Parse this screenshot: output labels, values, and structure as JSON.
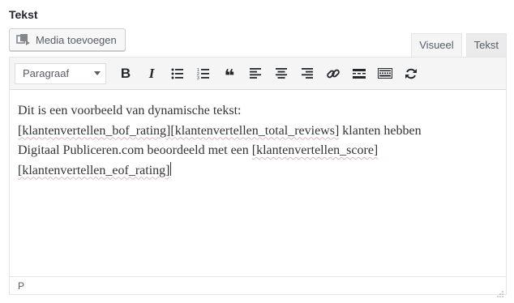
{
  "field": {
    "label": "Tekst"
  },
  "media": {
    "button_label": "Media toevoegen",
    "icon": "media-icon"
  },
  "tabs": {
    "visual": "Visueel",
    "text": "Tekst"
  },
  "toolbar": {
    "format_value": "Paragraaf",
    "buttons": [
      {
        "name": "bold-icon",
        "glyph": "B"
      },
      {
        "name": "italic-icon",
        "glyph": "I"
      },
      {
        "name": "bullet-list-icon"
      },
      {
        "name": "numbered-list-icon"
      },
      {
        "name": "blockquote-icon",
        "glyph": "❝"
      },
      {
        "name": "align-left-icon"
      },
      {
        "name": "align-center-icon"
      },
      {
        "name": "align-right-icon"
      },
      {
        "name": "link-icon"
      },
      {
        "name": "read-more-icon"
      },
      {
        "name": "toolbar-toggle-icon"
      },
      {
        "name": "refresh-icon"
      }
    ]
  },
  "content": {
    "line1": "Dit is een voorbeeld van dynamische tekst:",
    "sc_bof": "[klantenvertellen_bof_rating]",
    "sc_total": "[klantenvertellen_total_reviews]",
    "text_after_total": " klanten hebben",
    "line3_prefix": "Digitaal Publiceren.com beoordeeld met een ",
    "sc_score": "[klantenvertellen_score]",
    "sc_eof": "[klantenvertellen_eof_rating]"
  },
  "status": {
    "path": "P"
  },
  "colors": {
    "toolbar_bg": "#f5f5f5",
    "border": "#e5e5e5",
    "text": "#333333",
    "spellcheck": "#e0b7b7"
  }
}
